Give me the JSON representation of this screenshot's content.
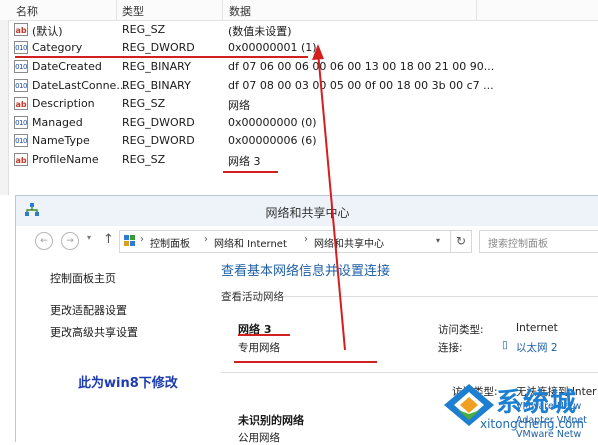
{
  "registry": {
    "columns": {
      "name": "名称",
      "type": "类型",
      "data": "数据"
    },
    "rows": [
      {
        "icon": "ab",
        "name": "(默认)",
        "type": "REG_SZ",
        "data": "(数值未设置)"
      },
      {
        "icon": "bin",
        "name": "Category",
        "type": "REG_DWORD",
        "data": "0x00000001 (1)"
      },
      {
        "icon": "bin",
        "name": "DateCreated",
        "type": "REG_BINARY",
        "data": "df 07 06 00 06 00 06 00 13 00 18 00 21 00 90..."
      },
      {
        "icon": "bin",
        "name": "DateLastConne...",
        "type": "REG_BINARY",
        "data": "df 07 08 00 03 00 05 00 0f 00 18 00 3b 00 c7 ..."
      },
      {
        "icon": "ab",
        "name": "Description",
        "type": "REG_SZ",
        "data": "网络"
      },
      {
        "icon": "bin",
        "name": "Managed",
        "type": "REG_DWORD",
        "data": "0x00000000 (0)"
      },
      {
        "icon": "bin",
        "name": "NameType",
        "type": "REG_DWORD",
        "data": "0x00000006 (6)"
      },
      {
        "icon": "ab",
        "name": "ProfileName",
        "type": "REG_SZ",
        "data": "网络  3"
      }
    ]
  },
  "nsc": {
    "window_title": "网络和共享中心",
    "address": {
      "crumbs": [
        "控制面板",
        "网络和 Internet",
        "网络和共享中心"
      ]
    },
    "search_placeholder": "搜索控制面板",
    "sidebar": [
      "控制面板主页",
      "更改适配器设置",
      "更改高级共享设置"
    ],
    "heading": "查看基本网络信息并设置连接",
    "subheading": "查看活动网络",
    "network1": {
      "name": "网络  3",
      "category": "专用网络",
      "access_label": "访问类型:",
      "access_value": "Internet",
      "conn_label": "连接:",
      "conn_value": "以太网 2"
    },
    "network2": {
      "name": "未识别的网络",
      "category": "公用网络",
      "access_label": "访问类型:",
      "access_value": "无法连接到 Inter",
      "conn_value1": "VMware Netw",
      "conn_value2": "Adapter VMnet",
      "conn_value3": "VMware Netw"
    },
    "annotation": "此为win8下修改"
  },
  "watermark": {
    "big": "系统城",
    "small": "xitongcheng.com"
  },
  "colors": {
    "red_annotation": "#d21f1f",
    "link_blue": "#1e5fa8",
    "annotation_blue": "#1c3cb0"
  }
}
